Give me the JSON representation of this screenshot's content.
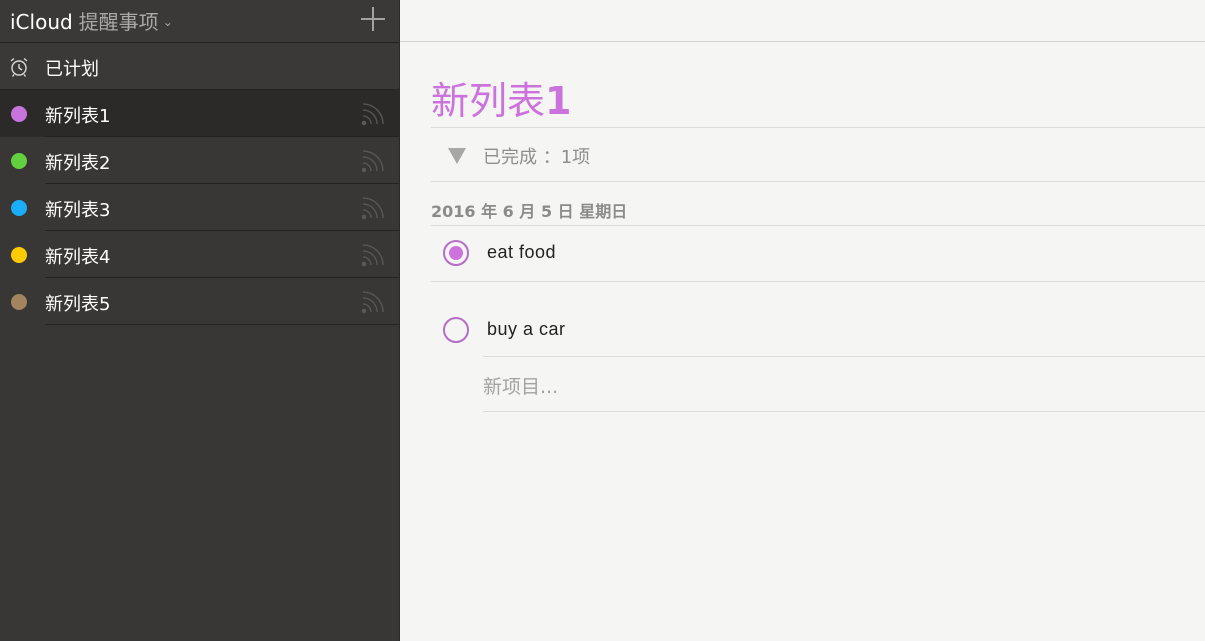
{
  "sidebar": {
    "title": "iCloud",
    "subtitle": "提醒事项",
    "scheduled_label": "已计划",
    "lists": [
      {
        "label": "新列表1",
        "color": "#c874dd"
      },
      {
        "label": "新列表2",
        "color": "#63d13e"
      },
      {
        "label": "新列表3",
        "color": "#1badf8"
      },
      {
        "label": "新列表4",
        "color": "#fecb00"
      },
      {
        "label": "新列表5",
        "color": "#a2845e"
      }
    ]
  },
  "main": {
    "title_text": "新列表",
    "title_num": "1",
    "completed_label": "已完成 ：1项",
    "date_label": "2016 年 6 月 5 日 星期日",
    "tasks": [
      {
        "text": "eat food",
        "completed": true
      },
      {
        "text": "buy a car",
        "completed": false
      }
    ],
    "new_item_placeholder": "新项目..."
  },
  "colors": {
    "accent": "#cc72dc",
    "sidebar_bg": "#383736"
  }
}
